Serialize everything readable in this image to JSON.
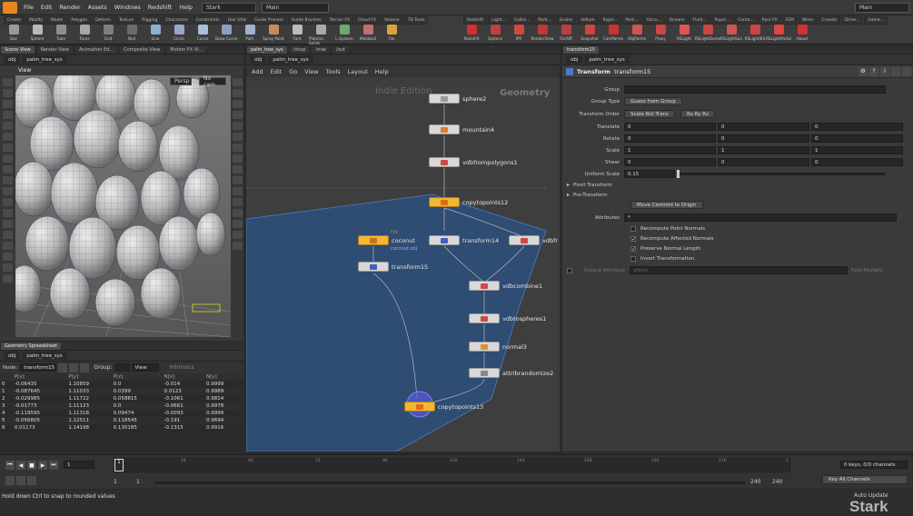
{
  "menubar": {
    "items": [
      "File",
      "Edit",
      "Render",
      "Assets",
      "Windows",
      "Redshift",
      "Help"
    ],
    "desktop": "Stark",
    "main_desk": "Main"
  },
  "shelf": {
    "tabs_left": [
      "Create",
      "Modify",
      "Model",
      "Polygon",
      "Deform",
      "Texture",
      "Rigging",
      "Characters",
      "Constraints",
      "Hair Utils",
      "Guide Process",
      "Guide Brushes",
      "Terrain FX",
      "Cloud FX",
      "Volume",
      "TD Tools"
    ],
    "tabs_right": [
      "Redshift",
      "Light...",
      "Collisi...",
      "Parti...",
      "Grains",
      "Vellum",
      "Rigid...",
      "Parti...",
      "Visco...",
      "Oceans",
      "Fluid...",
      "Popul...",
      "Conta...",
      "Pyro FX",
      "FEM",
      "Wires",
      "Crowds",
      "Drive...",
      "Game..."
    ],
    "tools_left": [
      {
        "label": "Box",
        "color": "#9a9a9a"
      },
      {
        "label": "Sphere",
        "color": "#b8b8b8"
      },
      {
        "label": "Tube",
        "color": "#8f8f8f"
      },
      {
        "label": "Torus",
        "color": "#a7a7a7"
      },
      {
        "label": "Grid",
        "color": "#7f7f7f"
      },
      {
        "label": "Null",
        "color": "#6c6c6c"
      },
      {
        "label": "Line",
        "color": "#8bb0d0"
      },
      {
        "label": "Circle",
        "color": "#9aa6c7"
      },
      {
        "label": "Curve",
        "color": "#a8c0d8"
      },
      {
        "label": "Draw Curve",
        "color": "#8aa0c0"
      },
      {
        "label": "Path",
        "color": "#9fb3cf"
      },
      {
        "label": "Spray Paint",
        "color": "#c98b5a"
      },
      {
        "label": "Font",
        "color": "#bbbbbb"
      },
      {
        "label": "Platonic Solids",
        "color": "#a9a9a9"
      },
      {
        "label": "L-System",
        "color": "#6fa86f"
      },
      {
        "label": "Metaball",
        "color": "#c07070"
      },
      {
        "label": "File",
        "color": "#e0a040"
      }
    ],
    "tools_right": [
      {
        "label": "Redshift",
        "color": "#d03030"
      },
      {
        "label": "Options",
        "color": "#c04040"
      },
      {
        "label": "IPR",
        "color": "#d04a3a"
      },
      {
        "label": "RenderView",
        "color": "#c03838"
      },
      {
        "label": "On/Off",
        "color": "#b84040"
      },
      {
        "label": "Snapshot",
        "color": "#c44"
      },
      {
        "label": "ComParms",
        "color": "#c33"
      },
      {
        "label": "ObjParms",
        "color": "#c55"
      },
      {
        "label": "Proxy",
        "color": "#c44"
      },
      {
        "label": "RSLight",
        "color": "#d55"
      },
      {
        "label": "RSLightDome",
        "color": "#c44"
      },
      {
        "label": "RSLightSun",
        "color": "#c55"
      },
      {
        "label": "RSLightIES",
        "color": "#c44"
      },
      {
        "label": "RSLightPortal",
        "color": "#d44"
      },
      {
        "label": "About",
        "color": "#c33"
      }
    ]
  },
  "left_panel": {
    "tabs": [
      "Scene View",
      "Render View",
      "Animation Ed...",
      "Composite View",
      "Motion FX Vi..."
    ],
    "path": [
      "obj",
      "palm_tree_sys"
    ],
    "viewport_label": "View",
    "persp": "Persp",
    "cam": "No cam",
    "tools_left": [
      "select",
      "move",
      "rotate",
      "scale",
      "handle",
      "pose",
      "paint",
      "magnet",
      "brush",
      "sculpt",
      "view",
      "render",
      "pin",
      "snap",
      "light",
      "cam",
      "loop",
      "mirror",
      "render-region"
    ],
    "tools_right": [
      "display",
      "wire",
      "shade",
      "ghost",
      "points",
      "normals",
      "hull",
      "vis",
      "grid",
      "cam-lock",
      "persp",
      "home",
      "frame",
      "pivot",
      "snap2",
      "shade2"
    ]
  },
  "spreadsheet": {
    "tabs": [
      "Geometry Spreadsheet"
    ],
    "path": [
      "obj",
      "palm_tree_sys"
    ],
    "node_label": "Node:",
    "node_value": "transform15",
    "group_label": "Group:",
    "view_label": "View",
    "intrinsics_label": "Intrinsics",
    "columns": [
      "",
      "P[x]",
      "P[y]",
      "P[z]",
      "N[x]",
      "N[y]"
    ],
    "rows": [
      [
        "0",
        "-0.06435",
        "1.10859",
        "0.0",
        "-0.014",
        "0.9999"
      ],
      [
        "1",
        "-0.087645",
        "1.11033",
        "0.0399",
        "0.0123",
        "0.9989"
      ],
      [
        "2",
        "-0.029985",
        "1.11722",
        "0.058815",
        "-0.1061",
        "0.9814"
      ],
      [
        "3",
        "-0.01773",
        "1.11123",
        "0.0",
        "-0.0661",
        "0.9978"
      ],
      [
        "4",
        "-0.119595",
        "1.11318",
        "0.09474",
        "-0.0093",
        "0.9999"
      ],
      [
        "5",
        "-0.056805",
        "1.12511",
        "0.118545",
        "-0.191",
        "0.9694"
      ],
      [
        "6",
        "0.01173",
        "1.14198",
        "0.130185",
        "-0.1315",
        "0.9916"
      ]
    ]
  },
  "network": {
    "tabs": [
      "palm_tree_sys",
      "/shop",
      "/mat",
      "/out"
    ],
    "path": [
      "obj",
      "palm_tree_sys"
    ],
    "menu": [
      "Add",
      "Edit",
      "Go",
      "View",
      "Tools",
      "Layout",
      "Help"
    ],
    "watermark": "Indie Edition",
    "context_label": "Geometry",
    "nodes": [
      {
        "id": "sphere2",
        "label": "sphere2",
        "yellow": false,
        "icon": "#9a9a9a"
      },
      {
        "id": "mountain4",
        "label": "mountain4",
        "yellow": false,
        "icon": "#e07a30"
      },
      {
        "id": "vdbfrompolygons1",
        "label": "vdbfrompolygons1",
        "yellow": false,
        "icon": "#d04848"
      },
      {
        "id": "copytopoints12",
        "label": "copytopoints12",
        "yellow": true,
        "icon": "#e06a20"
      },
      {
        "id": "coconut",
        "label": "coconut",
        "yellow": true,
        "icon": "#d07020",
        "sublabel": "coconut.obj",
        "file_tag": "File"
      },
      {
        "id": "transform14",
        "label": "transform14",
        "yellow": false,
        "icon": "#4060c0"
      },
      {
        "id": "vdbfr",
        "label": "vdbfr",
        "yellow": false,
        "icon": "#d04848"
      },
      {
        "id": "transform15",
        "label": "transform15",
        "yellow": false,
        "icon": "#4060c0"
      },
      {
        "id": "vdbcombine1",
        "label": "vdbcombine1",
        "yellow": false,
        "icon": "#d04848"
      },
      {
        "id": "vdbtospheres1",
        "label": "vdbtospheres1",
        "yellow": false,
        "icon": "#d04848"
      },
      {
        "id": "normal3",
        "label": "normal3",
        "yellow": false,
        "icon": "#e09030"
      },
      {
        "id": "attribrandomize2",
        "label": "attribrandomize2",
        "yellow": false,
        "icon": "#888888"
      },
      {
        "id": "copytopoints13",
        "label": "copytopoints13",
        "yellow": true,
        "icon": "#e06a20"
      }
    ]
  },
  "params": {
    "tab": "transform15",
    "path": [
      "obj",
      "palm_tree_sys"
    ],
    "node_type": "Transform",
    "node_name": "transform15",
    "group_label": "Group",
    "group_type_label": "Group Type",
    "group_type_value": "Guess from Group",
    "transform_order_label": "Transform Order",
    "transform_order_value": "Scale Rot Trans",
    "rot_order_value": "Rx Ry Rz",
    "translate_label": "Translate",
    "translate": [
      "0",
      "0",
      "0"
    ],
    "rotate_label": "Rotate",
    "rotate": [
      "0",
      "0",
      "0"
    ],
    "scale_label": "Scale",
    "scale": [
      "1",
      "1",
      "1"
    ],
    "shear_label": "Shear",
    "shear": [
      "0",
      "0",
      "0"
    ],
    "uniform_scale_label": "Uniform Scale",
    "uniform_scale": "0.15",
    "pivot_label": "Pivot Transform",
    "pre_label": "Pre-Transform",
    "move_centroid": "Move Centroid to Origin",
    "attributes_label": "Attributes",
    "attributes_value": "*",
    "recompute_point": "Recompute Point Normals",
    "recompute_affected": "Recompute Affected Normals",
    "preserve_length": "Preserve Normal Length",
    "invert": "Invert Transformation",
    "output_attr_label": "Output Attribute",
    "output_attr_value": "xform",
    "post_multiply": "Post-Multiply"
  },
  "timeline": {
    "frame": "1",
    "start": "1",
    "start2": "1",
    "end": "240",
    "end2": "240",
    "ticks": [
      "24",
      "48",
      "72",
      "96",
      "120",
      "144",
      "168",
      "192",
      "216",
      "2"
    ],
    "keys_label": "0 keys, 0/0 channels",
    "key_all": "Key All Channels"
  },
  "status": {
    "message": "Hold down Ctrl to snap to rounded values",
    "update": "Auto Update",
    "brand": "Stark"
  }
}
